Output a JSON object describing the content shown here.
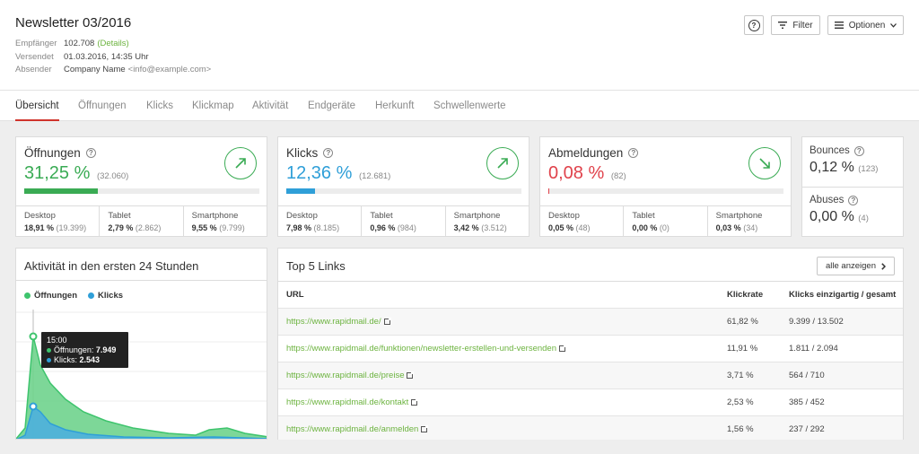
{
  "header": {
    "title": "Newsletter 03/2016",
    "meta": [
      {
        "key": "Empfänger",
        "value": "102.708",
        "link": "(Details)"
      },
      {
        "key": "Versendet",
        "value": "01.03.2016, 14:35 Uhr"
      },
      {
        "key": "Absender",
        "value": "Company Name",
        "extra": "<info@example.com>"
      }
    ],
    "help_label": "?",
    "filter_label": "Filter",
    "options_label": "Optionen"
  },
  "tabs": [
    {
      "label": "Übersicht",
      "active": true
    },
    {
      "label": "Öffnungen"
    },
    {
      "label": "Klicks"
    },
    {
      "label": "Klickmap"
    },
    {
      "label": "Aktivität"
    },
    {
      "label": "Endgeräte"
    },
    {
      "label": "Herkunft"
    },
    {
      "label": "Schwellenwerte"
    }
  ],
  "stats": [
    {
      "name": "Öffnungen",
      "value": "31,25 %",
      "sub": "(32.060)",
      "color": "#3aab54",
      "progress": 0.3125,
      "trend": "up",
      "splits": [
        {
          "label": "Desktop",
          "value": "18,91 %",
          "sub": "(19.399)"
        },
        {
          "label": "Tablet",
          "value": "2,79 %",
          "sub": "(2.862)"
        },
        {
          "label": "Smartphone",
          "value": "9,55 %",
          "sub": "(9.799)"
        }
      ]
    },
    {
      "name": "Klicks",
      "value": "12,36 %",
      "sub": "(12.681)",
      "color": "#2f9fd8",
      "progress": 0.1236,
      "trend": "up",
      "splits": [
        {
          "label": "Desktop",
          "value": "7,98 %",
          "sub": "(8.185)"
        },
        {
          "label": "Tablet",
          "value": "0,96 %",
          "sub": "(984)"
        },
        {
          "label": "Smartphone",
          "value": "3,42 %",
          "sub": "(3.512)"
        }
      ]
    },
    {
      "name": "Abmeldungen",
      "value": "0,08 %",
      "sub": "(82)",
      "color": "#e0424b",
      "progress": 0.0008,
      "trend": "down",
      "splits": [
        {
          "label": "Desktop",
          "value": "0,05 %",
          "sub": "(48)"
        },
        {
          "label": "Tablet",
          "value": "0,00 %",
          "sub": "(0)"
        },
        {
          "label": "Smartphone",
          "value": "0,03 %",
          "sub": "(34)"
        }
      ]
    }
  ],
  "mini": [
    {
      "name": "Bounces",
      "value": "0,12 %",
      "sub": "(123)"
    },
    {
      "name": "Abuses",
      "value": "0,00 %",
      "sub": "(4)"
    }
  ],
  "activity": {
    "title": "Aktivität in den ersten 24 Stunden",
    "legend": [
      {
        "label": "Öffnungen",
        "color": "#3ec46d"
      },
      {
        "label": "Klicks",
        "color": "#2f9fd8"
      }
    ],
    "tooltip": {
      "time": "15:00",
      "opens_label": "Öffnungen:",
      "opens_value": "7.949",
      "clicks_label": "Klicks:",
      "clicks_value": "2.543"
    }
  },
  "links": {
    "title": "Top 5 Links",
    "all_label": "alle anzeigen",
    "columns": [
      "URL",
      "Klickrate",
      "Klicks einzigartig / gesamt"
    ],
    "rows": [
      {
        "url": "https://www.rapidmail.de/",
        "rate": "61,82 %",
        "clicks": "9.399 / 13.502"
      },
      {
        "url": "https://www.rapidmail.de/funktionen/newsletter-erstellen-und-versenden",
        "rate": "11,91 %",
        "clicks": "1.811 / 2.094"
      },
      {
        "url": "https://www.rapidmail.de/preise",
        "rate": "3,71 %",
        "clicks": "564 / 710"
      },
      {
        "url": "https://www.rapidmail.de/kontakt",
        "rate": "2,53 %",
        "clicks": "385 / 452"
      },
      {
        "url": "https://www.rapidmail.de/anmelden",
        "rate": "1,56 %",
        "clicks": "237 / 292"
      }
    ]
  }
}
